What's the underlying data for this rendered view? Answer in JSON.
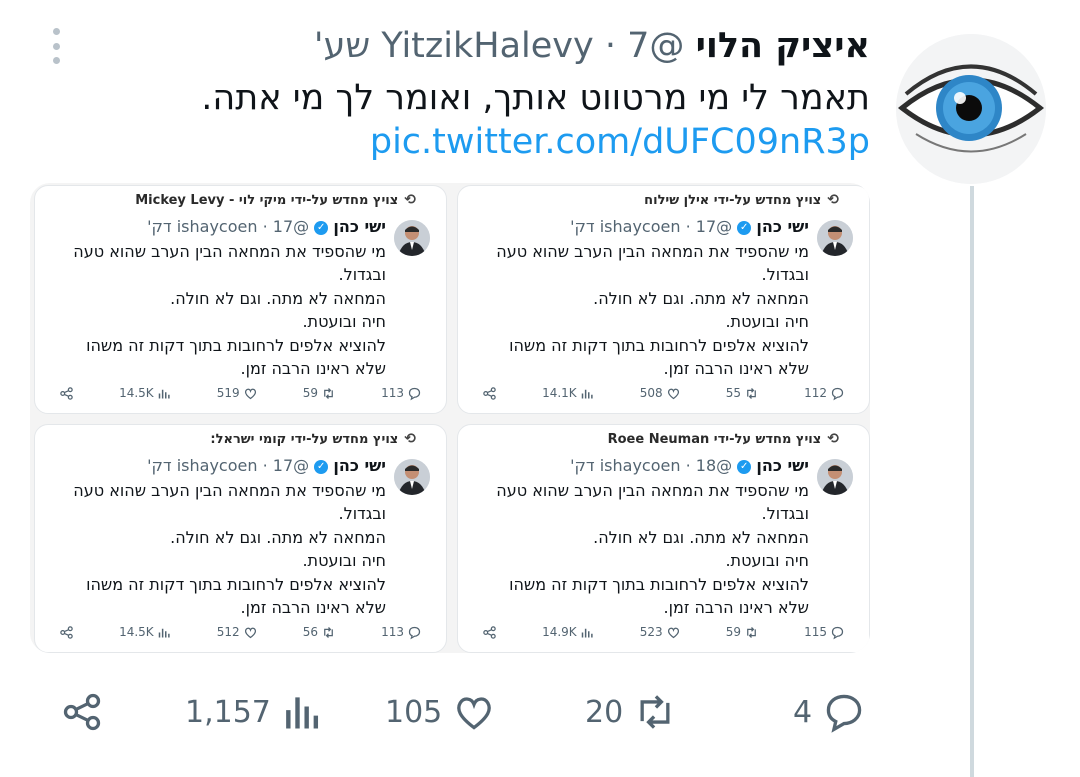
{
  "tweet": {
    "author_name": "איציק הלוי",
    "handle": "@YitzikHalevy",
    "separator": "·",
    "time": "7 שע'",
    "text": "תאמר לי מי מרטווט אותך, ואומר לך מי אתה.",
    "link": "pic.twitter.com/dUFC09nR3p"
  },
  "cards": [
    {
      "retweeted_by": "צויץ מחדש על-ידי אילן שילוח",
      "name": "ישי כהן",
      "handle": "@ishaycoen",
      "time": "17 דק'",
      "lines": [
        "מי שהספיד את המחאה הבין הערב שהוא טעה",
        "ובגדול.",
        "המחאה לא מתה. וגם לא חולה.",
        "חיה ובועטת.",
        "להוציא אלפים לרחובות בתוך דקות זה משהו",
        "שלא ראינו הרבה זמן."
      ],
      "views": "14.1K",
      "likes": "508",
      "retweets": "55",
      "replies": "112"
    },
    {
      "retweeted_by": "צויץ מחדש על-ידי מיקי לוי - Mickey Levy",
      "name": "ישי כהן",
      "handle": "@ishaycoen",
      "time": "17 דק'",
      "lines": [
        "מי שהספיד את המחאה הבין הערב שהוא טעה",
        "ובגדול.",
        "המחאה לא מתה. וגם לא חולה.",
        "חיה ובועטת.",
        "להוציא אלפים לרחובות בתוך דקות זה משהו",
        "שלא ראינו הרבה זמן."
      ],
      "views": "14.5K",
      "likes": "519",
      "retweets": "59",
      "replies": "113"
    },
    {
      "retweeted_by": "צויץ מחדש על-ידי Roee Neuman",
      "name": "ישי כהן",
      "handle": "@ishaycoen",
      "time": "18 דק'",
      "lines": [
        "מי שהספיד את המחאה הבין הערב שהוא טעה",
        "ובגדול.",
        "המחאה לא מתה. וגם לא חולה.",
        "חיה ובועטת.",
        "להוציא אלפים לרחובות בתוך דקות זה משהו",
        "שלא ראינו הרבה זמן."
      ],
      "views": "14.9K",
      "likes": "523",
      "retweets": "59",
      "replies": "115"
    },
    {
      "retweeted_by": "צויץ מחדש על-ידי קומי ישראל:",
      "name": "ישי כהן",
      "handle": "@ishaycoen",
      "time": "17 דק'",
      "lines": [
        "מי שהספיד את המחאה הבין הערב שהוא טעה",
        "ובגדול.",
        "המחאה לא מתה. וגם לא חולה.",
        "חיה ובועטת.",
        "להוציא אלפים לרחובות בתוך דקות זה משהו",
        "שלא ראינו הרבה זמן."
      ],
      "views": "14.5K",
      "likes": "512",
      "retweets": "56",
      "replies": "113"
    }
  ],
  "actions": {
    "replies": "4",
    "retweets": "20",
    "likes": "105",
    "views": "1,157"
  },
  "colors": {
    "link": "#1d9bf0",
    "secondary_text": "#536471",
    "verified": "#1d9bf0"
  },
  "icons": [
    "more-icon",
    "retweet-icon",
    "verified-icon",
    "share-icon",
    "views-icon",
    "like-icon",
    "reply-icon"
  ]
}
